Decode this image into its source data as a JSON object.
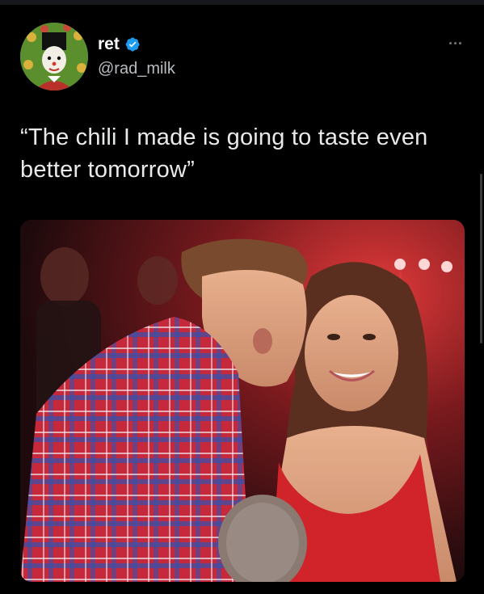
{
  "tweet": {
    "author": {
      "display_name": "ret",
      "handle": "@rad_milk",
      "verified": true,
      "avatar_icon": "avatar-clown-portrait"
    },
    "text": "“The chili I made is going to taste even better tomorrow”",
    "more_icon": "more-dots-icon",
    "media": {
      "type": "photo"
    }
  },
  "colors": {
    "background": "#000000",
    "text": "#e7e9ea",
    "secondary_text": "#b9bcc0",
    "verified_blue": "#1d9bf0"
  }
}
